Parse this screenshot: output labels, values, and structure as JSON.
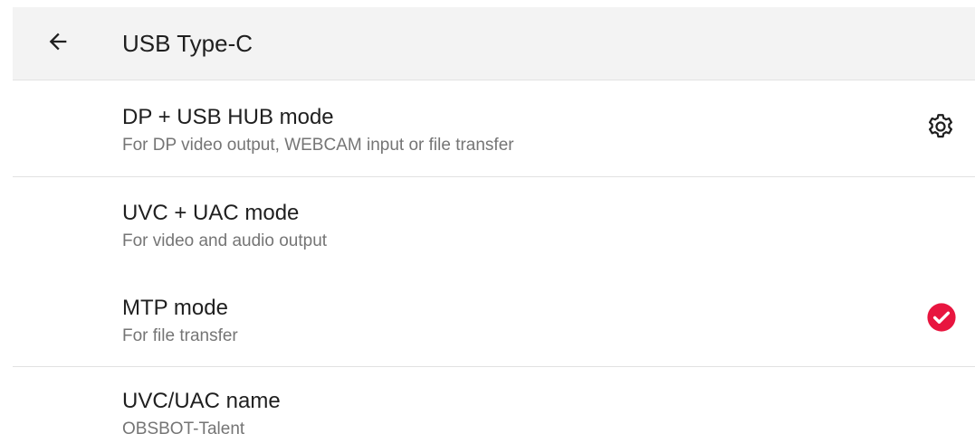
{
  "header": {
    "title": "USB Type-C",
    "back_icon": "arrow-left-icon"
  },
  "items": [
    {
      "title": "DP + USB HUB mode",
      "subtitle": "For DP video output, WEBCAM input or file transfer",
      "trailing_icon": "gear-icon"
    },
    {
      "title": "UVC + UAC mode",
      "subtitle": "For video and audio output"
    },
    {
      "title": "MTP mode",
      "subtitle": "For file transfer",
      "trailing_icon": "check-circle-icon",
      "selected": true
    },
    {
      "title": "UVC/UAC name",
      "subtitle": "OBSBOT-Talent"
    }
  ],
  "colors": {
    "accent": "#e8153f",
    "header_bg": "#f3f3f3",
    "divider": "#e2e2e2",
    "primary_text": "#1f1f1f",
    "secondary_text": "#757575"
  }
}
